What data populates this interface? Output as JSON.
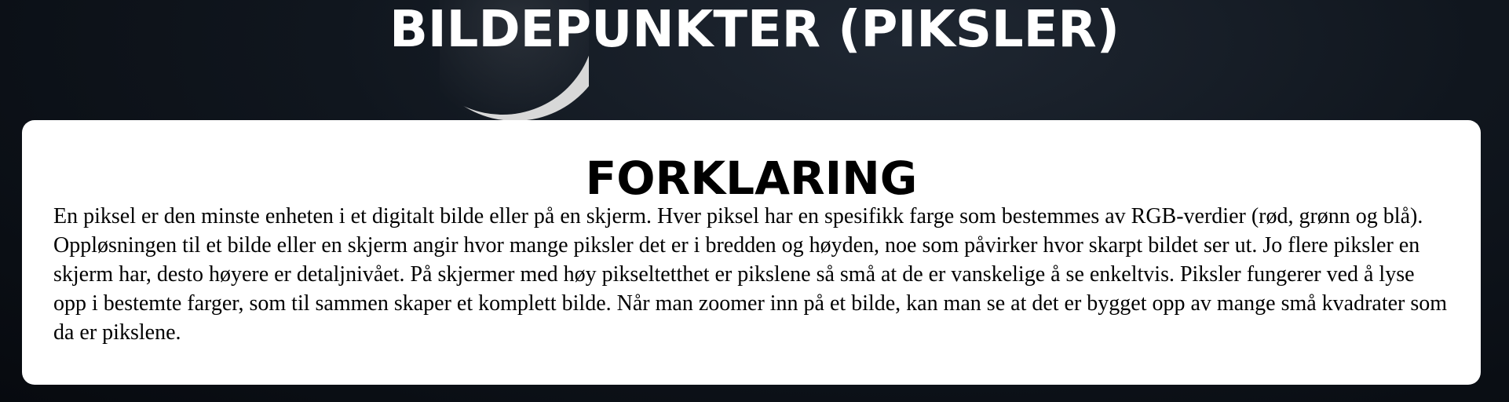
{
  "header": {
    "title": "BILDEPUNKTER (PIKSLER)"
  },
  "background": {
    "decoration_icon": "crescent-moon-icon"
  },
  "panel": {
    "heading": "FORKLARING",
    "text": "En piksel er den minste enheten i et digitalt bilde eller på en skjerm. Hver piksel har en spesifikk farge som bestemmes av RGB-verdier (rød, grønn og blå). Oppløsningen til et bilde eller en skjerm angir hvor mange piksler det er i bredden og høyden, noe som påvirker hvor skarpt bildet ser ut. Jo flere piksler en skjerm har, desto høyere er detaljnivået. På skjermer med høy pikseltetthet er pikslene så små at de er vanskelige å se enkeltvis. Piksler fungerer ved å lyse opp i bestemte farger, som til sammen skaper et komplett bilde. Når man zoomer inn på et bilde, kan man se at det er bygget opp av mange små kvadrater som da er pikslene."
  },
  "colors": {
    "background": "#0b1016",
    "title_text": "#ffffff",
    "panel_background": "#ffffff",
    "panel_text": "#000000"
  }
}
